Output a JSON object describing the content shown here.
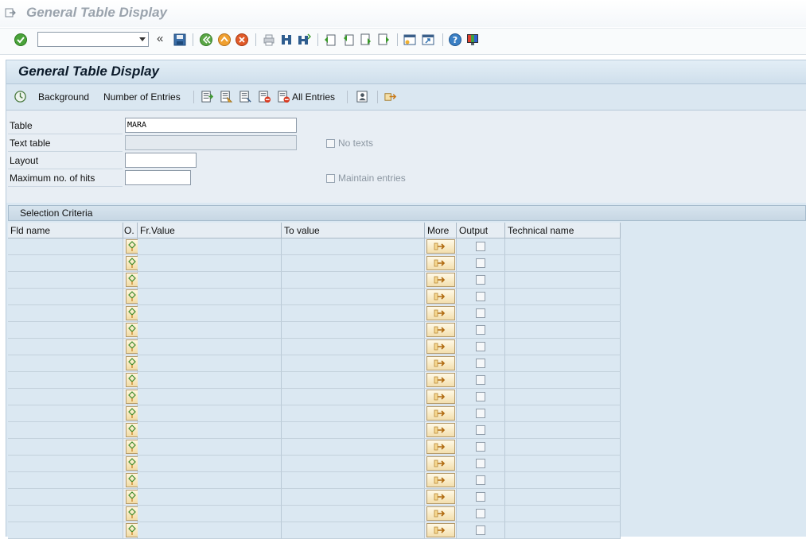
{
  "window": {
    "title": "General Table Display"
  },
  "toolbar": {
    "command_field_value": "",
    "icons": [
      "enter-icon",
      "double-chevron-icon",
      "save-icon",
      "back-icon",
      "exit-icon",
      "cancel-icon",
      "print-icon",
      "find-icon",
      "find-next-icon",
      "first-page-icon",
      "previous-page-icon",
      "next-page-icon",
      "last-page-icon",
      "create-session-icon",
      "shortcut-icon",
      "help-icon",
      "customize-layout-icon"
    ]
  },
  "screen": {
    "title": "General Table Display"
  },
  "app_toolbar": {
    "background_label": "Background",
    "number_of_entries_label": "Number of Entries",
    "all_entries_label": "All Entries"
  },
  "form": {
    "table_label": "Table",
    "table_value": "MARA",
    "text_table_label": "Text table",
    "text_table_value": "",
    "layout_label": "Layout",
    "layout_value": "",
    "max_hits_label": "Maximum no. of hits",
    "max_hits_value": "",
    "no_texts_label": "No texts",
    "maintain_entries_label": "Maintain entries"
  },
  "selection": {
    "title": "Selection Criteria",
    "columns": {
      "fld_name": "Fld name",
      "option": "O.",
      "from_value": "Fr.Value",
      "to_value": "To value",
      "more": "More",
      "output": "Output",
      "technical_name": "Technical name"
    },
    "row_count": 18
  }
}
